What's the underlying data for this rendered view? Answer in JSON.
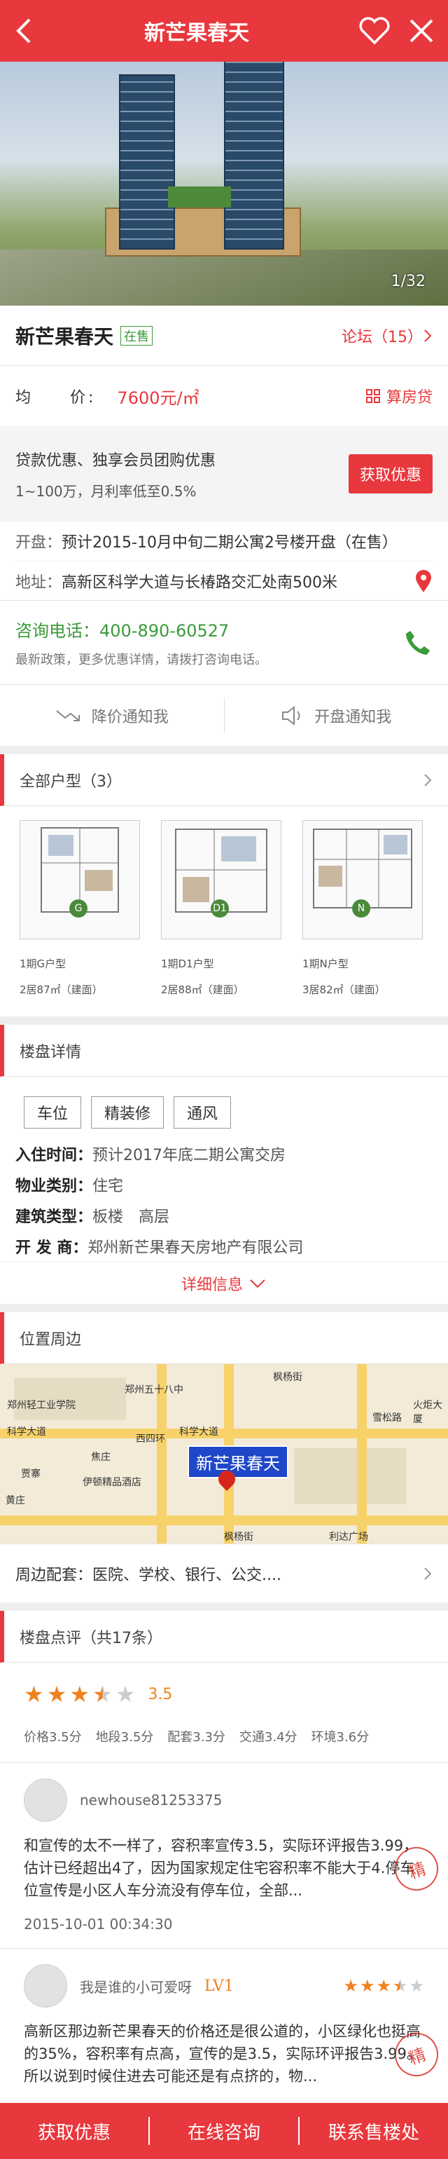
{
  "header": {
    "title": "新芒果春天"
  },
  "gallery": {
    "counter": "1/32"
  },
  "project": {
    "name": "新芒果春天",
    "status": "在售",
    "forum": "论坛（15）"
  },
  "price": {
    "label": "均　　价:",
    "value": "7600元/㎡",
    "calc": "算房贷"
  },
  "promo": {
    "line1": "贷款优惠、独享会员团购优惠",
    "line2": "1~100万，月利率低至0.5%",
    "button": "获取优惠"
  },
  "info": {
    "open_label": "开盘：",
    "open_value": "预计2015-10月中旬二期公寓2号楼开盘（在售）",
    "addr_label": "地址：",
    "addr_value": "高新区科学大道与长椿路交汇处南500米"
  },
  "tel": {
    "label": "咨询电话：",
    "number": "400-890-60527",
    "note": "最新政策，更多优惠详情，请拨打咨询电话。"
  },
  "notify": {
    "price_drop": "降价通知我",
    "open": "开盘通知我"
  },
  "floorplans": {
    "title": "全部户型（3）",
    "items": [
      {
        "badge": "G",
        "name": "1期G户型",
        "spec": "2居87㎡（建面）"
      },
      {
        "badge": "D1",
        "name": "1期D1户型",
        "spec": "2居88㎡（建面）"
      },
      {
        "badge": "N",
        "name": "1期N户型",
        "spec": "3居82㎡（建面）"
      }
    ]
  },
  "details": {
    "title": "楼盘详情",
    "tags": [
      "车位",
      "精装修",
      "通风"
    ],
    "rows": [
      {
        "k": "入住时间：",
        "v": "预计2017年底二期公寓交房"
      },
      {
        "k": "物业类别：",
        "v": "住宅"
      },
      {
        "k": "建筑类型：",
        "v": "板楼　高层"
      },
      {
        "k": "开 发 商：",
        "v": "郑州新芒果春天房地产有限公司"
      }
    ],
    "more": "详细信息"
  },
  "location": {
    "title": "位置周边",
    "map_label": "新芒果春天",
    "streets": [
      "郑州五十八中",
      "枫杨街",
      "科学大道",
      "西四环",
      "雪松路",
      "伊顿精品酒店",
      "焦庄",
      "贾寨",
      "黄庄",
      "利达广场",
      "郑州轻工业学院",
      "火炬大厦",
      "枫杨街"
    ],
    "around": "周边配套：医院、学校、银行、公交...."
  },
  "reviews": {
    "title": "楼盘点评（共17条）",
    "rating": 3.5,
    "score": "3.5",
    "subscores": [
      "价格3.5分",
      "地段3.5分",
      "配套3.3分",
      "交通3.4分",
      "环境3.6分"
    ],
    "items": [
      {
        "user": "newhouse81253375",
        "text": "和宣传的太不一样了，容积率宣传3.5，实际环评报告3.99，估计已经超出4了，因为国家规定住宅容积率不能大于4.停车位宣传是小区人车分流没有停车位，全部...",
        "time": "2015-10-01 00:34:30",
        "seal": "精"
      },
      {
        "user": "我是谁的小可爱呀",
        "level": "LV1",
        "rating": 3.5,
        "text": "高新区那边新芒果春天的价格还是很公道的，小区绿化也挺高的35%，容积率有点高，宣传的是3.5，实际环评报告3.99。所以说到时候住进去可能还是有点挤的，物...",
        "seal": "精"
      }
    ]
  },
  "bottom": {
    "discount": "获取优惠",
    "consult": "在线咨询",
    "contact": "联系售楼处"
  },
  "colors": {
    "primary": "#e8383d",
    "green": "#3a9b3a",
    "star": "#f0821e"
  }
}
